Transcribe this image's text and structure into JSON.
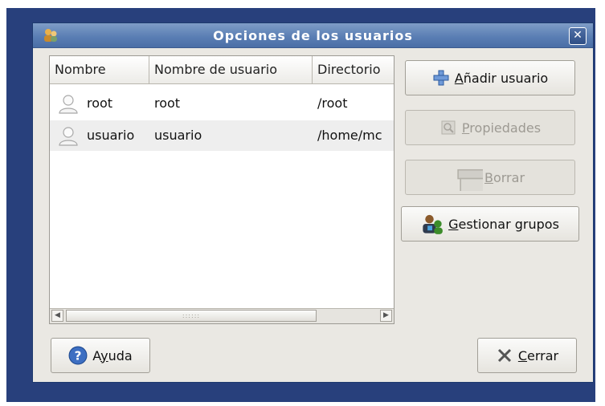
{
  "window": {
    "title": "Opciones de los usuarios",
    "close_glyph": "✕",
    "title_icon": "users-icon"
  },
  "table": {
    "columns": [
      "Nombre",
      "Nombre de usuario",
      "Directorio"
    ],
    "rows": [
      {
        "icon": "user-icon",
        "name": "root",
        "username": "root",
        "directory": "/root"
      },
      {
        "icon": "user-icon",
        "name": "usuario",
        "username": "usuario",
        "directory": "/home/mc"
      }
    ],
    "scroll": {
      "left_arrow": "◀",
      "right_arrow": "▶",
      "thumb_grip": "::::::"
    }
  },
  "buttons": {
    "add_user": {
      "mnemonic": "A",
      "rest": "ñadir usuario",
      "icon": "plus-icon",
      "enabled": true
    },
    "properties": {
      "mnemonic": "P",
      "rest": "ropiedades",
      "icon": "properties-icon",
      "enabled": false
    },
    "delete": {
      "mnemonic": "B",
      "rest": "orrar",
      "icon": "trash-icon",
      "enabled": false
    },
    "manage_groups": {
      "mnemonic": "G",
      "rest": "estionar grupos",
      "icon": "groups-icon",
      "enabled": true
    },
    "help": {
      "pre": "A",
      "mnemonic": "y",
      "rest": "uda",
      "icon": "help-icon",
      "enabled": true
    },
    "close": {
      "mnemonic": "C",
      "rest": "errar",
      "icon": "close-x-icon",
      "enabled": true
    }
  },
  "colors": {
    "titlebar": "#5b7fb4",
    "desktop_background": "#28407c",
    "dialog_background": "#eae8e3"
  }
}
